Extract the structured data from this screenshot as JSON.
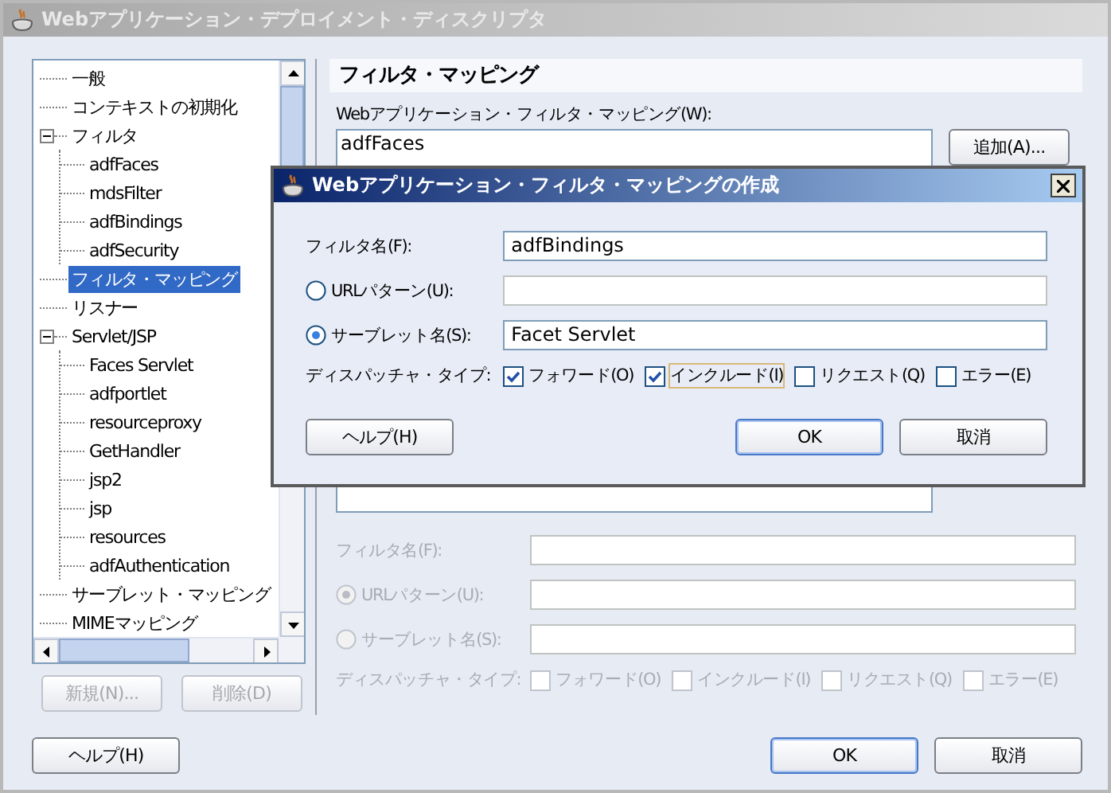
{
  "window": {
    "title": "Webアプリケーション・デプロイメント・ディスクリプタ"
  },
  "tree": {
    "items": [
      {
        "label": "一般",
        "selected": false
      },
      {
        "label": "コンテキストの初期化",
        "selected": false
      },
      {
        "label": "フィルタ",
        "selected": false,
        "expanded": true,
        "children": [
          {
            "label": "adfFaces",
            "selected": false
          },
          {
            "label": "mdsFilter",
            "selected": false
          },
          {
            "label": "adfBindings",
            "selected": false
          },
          {
            "label": "adfSecurity",
            "selected": false
          }
        ]
      },
      {
        "label": "フィルタ・マッピング",
        "selected": true
      },
      {
        "label": "リスナー",
        "selected": false
      },
      {
        "label": "Servlet/JSP",
        "selected": false,
        "expanded": true,
        "children": [
          {
            "label": "Faces Servlet",
            "selected": false
          },
          {
            "label": "adfportlet",
            "selected": false
          },
          {
            "label": "resourceproxy",
            "selected": false
          },
          {
            "label": "GetHandler",
            "selected": false
          },
          {
            "label": "jsp2",
            "selected": false
          },
          {
            "label": "jsp",
            "selected": false
          },
          {
            "label": "resources",
            "selected": false
          },
          {
            "label": "adfAuthentication",
            "selected": false
          }
        ]
      },
      {
        "label": "サーブレット・マッピング",
        "selected": false
      },
      {
        "label": "MIMEマッピング",
        "selected": false
      }
    ]
  },
  "tree_buttons": [
    {
      "label": "新規(N)...",
      "disabled": true
    },
    {
      "label": "削除(D)",
      "disabled": true
    }
  ],
  "panel": {
    "heading": "フィルタ・マッピング",
    "list_label": "Webアプリケーション・フィルタ・マッピング(W):",
    "list_items": [
      "adfFaces"
    ],
    "add_button": "追加(A)...",
    "form": {
      "disabled": true,
      "filter_name_label": "フィルタ名(F):",
      "options": [
        {
          "label": "URLパターン(U):",
          "selected": true
        },
        {
          "label": "サーブレット名(S):",
          "selected": false
        }
      ],
      "dispatcher_label": "ディスパッチャ・タイプ:",
      "dispatch_types": [
        {
          "label": "フォワード(O)",
          "checked": false
        },
        {
          "label": "インクルード(I)",
          "checked": false
        },
        {
          "label": "リクエスト(Q)",
          "checked": false
        },
        {
          "label": "エラー(E)",
          "checked": false
        }
      ]
    }
  },
  "buttons": [
    {
      "label": "ヘルプ(H)",
      "default": false
    },
    {
      "label": "OK",
      "default": true
    },
    {
      "label": "取消",
      "default": false
    }
  ],
  "dialog": {
    "title": "Webアプリケーション・フィルタ・マッピングの作成",
    "filter_name_label": "フィルタ名(F):",
    "filter_name": "adfBindings",
    "options": [
      {
        "label": "URLパターン(U):",
        "selected": false
      },
      {
        "label": "サーブレット名(S):",
        "selected": true,
        "value": "Facet Servlet"
      }
    ],
    "dispatcher_label": "ディスパッチャ・タイプ:",
    "dispatch_types": [
      {
        "label": "フォワード(O)",
        "checked": true,
        "focused": false
      },
      {
        "label": "インクルード(I)",
        "checked": true,
        "focused": true
      },
      {
        "label": "リクエスト(Q)",
        "checked": false,
        "focused": false
      },
      {
        "label": "エラー(E)",
        "checked": false,
        "focused": false
      }
    ],
    "buttons": [
      {
        "label": "ヘルプ(H)",
        "default": false
      },
      {
        "label": "OK",
        "default": true
      },
      {
        "label": "取消",
        "default": false
      }
    ]
  }
}
